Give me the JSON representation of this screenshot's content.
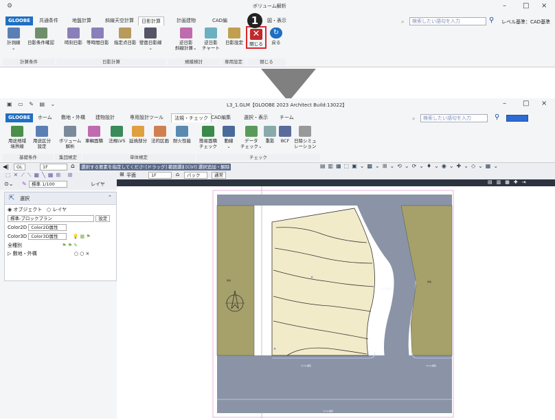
{
  "top": {
    "title": "ボリューム解析",
    "tabs": [
      "GLOOBE",
      "共通条件",
      "地盤計算",
      "斜線天空計算",
      "日影計算",
      "計画建物",
      "CAD編",
      "図・表示"
    ],
    "search_placeholder": "検索したい語句を入力",
    "level_text": "レベル基準：CAD基準",
    "buttons": [
      {
        "label": "計測線\n⌄"
      },
      {
        "label": "日影条件確認"
      },
      {
        "label": "時刻日影"
      },
      {
        "label": "等時間日影"
      },
      {
        "label": "指定点日影"
      },
      {
        "label": "壁面日影線\n⌄"
      },
      {
        "label": "逆日影\n斜線計算⌄"
      },
      {
        "label": "逆日影\nチャート"
      },
      {
        "label": "日影設定"
      },
      {
        "label": "閉じる"
      },
      {
        "label": "戻る"
      }
    ],
    "groups": [
      "計算条件",
      "日影計算",
      "規模検討",
      "専用設定",
      "閉じる"
    ],
    "callout_number": "1"
  },
  "bottom": {
    "title": "L3_1.GLM【GLOOBE 2023 Architect Build:13022】",
    "tabs": [
      "GLOOBE",
      "ホーム",
      "敷地・外構",
      "建物設計",
      "専用設計ツール",
      "法規・チェック",
      "CAD編集",
      "選択・表示",
      "チーム"
    ],
    "search_placeholder": "検索したい語句を入力",
    "buttons": [
      {
        "label": "用途地域\n境界線"
      },
      {
        "label": "用途区分\n設定"
      },
      {
        "label": "ボリューム\n解析"
      },
      {
        "label": "車輌面積"
      },
      {
        "label": "法規LVS"
      },
      {
        "label": "延焼部分"
      },
      {
        "label": "法的区画"
      },
      {
        "label": "耐火性能"
      },
      {
        "label": "簡易面積\nチェック"
      },
      {
        "label": "動線\n⌄"
      },
      {
        "label": "データ\nチェック⌄"
      },
      {
        "label": "重影"
      },
      {
        "label": "BCF"
      },
      {
        "label": "日除シミュ\nレーション"
      }
    ],
    "groups": [
      "基礎条件",
      "集団規定",
      "単体規定",
      "チェック"
    ],
    "floor_label": "GL",
    "floor_value": "1F",
    "hint": "選択する要素を指定してください。",
    "hint_drag": "[ドラッグ] 範囲選択",
    "hint_ctrl": "[Ctrl] 選択追加・解除",
    "scale": "標準 1/100",
    "layer": "レイヤ",
    "view_label": "平面",
    "view_floor": "1F",
    "view_back": "バック",
    "view_mode": "通常",
    "panel_title": "選択",
    "radio_object": "オブジェクト",
    "radio_layer": "レイヤ",
    "preset": "標準-ブロックプラン",
    "preset_btn": "設定",
    "color2d_label": "Color2D",
    "color2d_value": "Color2D属性",
    "color3d_label": "Color3D",
    "color3d_value": "Color3D属性",
    "all_kinds": "全種別",
    "tree_item": "敷地・外構",
    "road_label": "ｱｽﾌｧﾙﾄ舗装",
    "green_label": "緑地"
  },
  "colors": {
    "brand": "#1e6fc4",
    "road": "#8a94a6",
    "site": "#f2ebc9",
    "green": "#a6a06a",
    "callout": "#d9262b"
  }
}
